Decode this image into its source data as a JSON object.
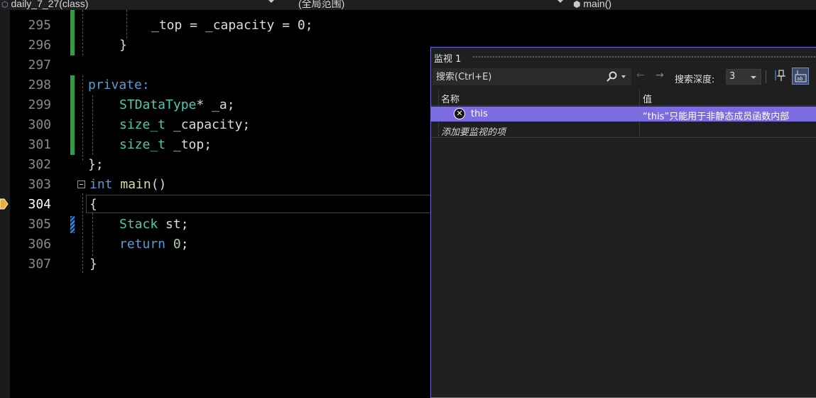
{
  "navbar": {
    "project": "daily_7_27(class)",
    "scope": "(全局范围)",
    "function": "main()"
  },
  "editor": {
    "line_numbers": [
      "295",
      "296",
      "297",
      "298",
      "299",
      "300",
      "301",
      "302",
      "303",
      "304",
      "305",
      "306",
      "307"
    ],
    "current_line": "304",
    "lines": {
      "l295": "_top = _capacity = 0;",
      "l296": "}",
      "l298": "private:",
      "l299_type": "STDataType",
      "l299_rest": "* _a;",
      "l300_type": "size_t",
      "l300_rest": " _capacity;",
      "l301_type": "size_t",
      "l301_rest": " _top;",
      "l302": "};",
      "l303_kw": "int",
      "l303_fn": "main",
      "l303_rest": "()",
      "l304": "{",
      "l305_type": "Stack",
      "l305_rest": " st;",
      "l306_kw": "return",
      "l306_num": "0",
      "l306_rest": ";",
      "l307": "}"
    }
  },
  "watch": {
    "title": "监视 1",
    "search_placeholder": "搜索(Ctrl+E)",
    "depth_label": "搜索深度:",
    "depth_value": "3",
    "columns": {
      "name": "名称",
      "value": "值"
    },
    "rows": [
      {
        "name": "this",
        "value": "“this”只能用于非静态成员函数内部"
      }
    ],
    "add_item": "添加要监视的项"
  }
}
